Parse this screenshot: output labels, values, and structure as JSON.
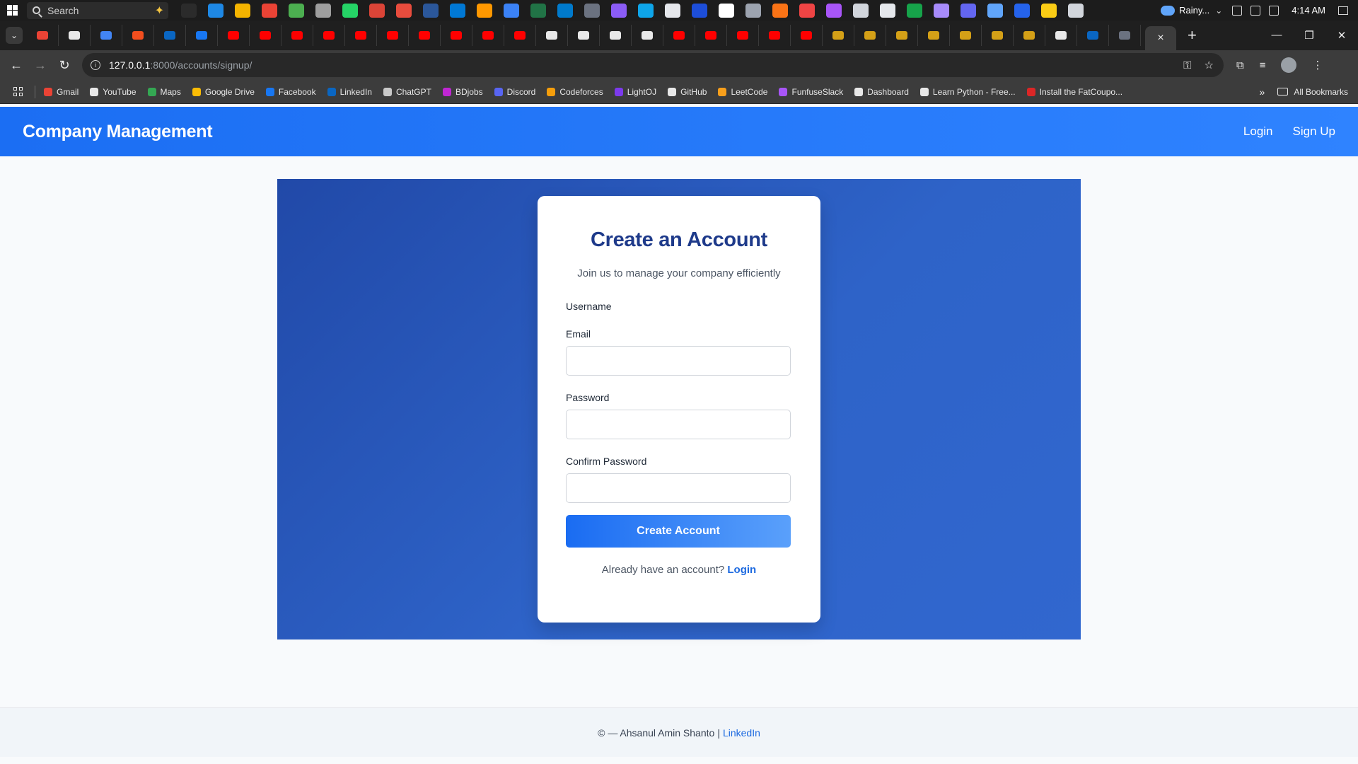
{
  "taskbar": {
    "search_placeholder": "Search",
    "weather": "Rainy...",
    "time": "4:14 AM",
    "app_colors": [
      "#2b2b2b",
      "#1e88e5",
      "#f4b400",
      "#ea4335",
      "#4caf50",
      "#9e9e9e",
      "#25d366",
      "#db4437",
      "#e84c3d",
      "#2b579a",
      "#0078d4",
      "#ff9800",
      "#3b82f6",
      "#217346",
      "#007acc",
      "#6b7280",
      "#8b5cf6",
      "#0ea5e9",
      "#e5e7eb",
      "#1d4ed8",
      "#ffffff",
      "#9ca3af",
      "#f97316",
      "#ef4444",
      "#a855f7",
      "#d1d5db",
      "#e5e7eb",
      "#16a34a",
      "#a78bfa",
      "#6366f1",
      "#60a5fa",
      "#2563eb",
      "#facc15",
      "#d1d5db"
    ]
  },
  "browser": {
    "pinned_tab_colors": [
      "#ea4335",
      "#e8e8e8",
      "#4285f4",
      "#f24e1e",
      "#0a66c2",
      "#1877f2",
      "#ff0000",
      "#ff0000",
      "#ff0000",
      "#ff0000",
      "#ff0000",
      "#ff0000",
      "#ff0000",
      "#ff0000",
      "#ff0000",
      "#ff0000",
      "#e8e8e8",
      "#e8e8e8",
      "#e8e8e8",
      "#e8e8e8",
      "#ff0000",
      "#ff0000",
      "#ff0000",
      "#ff0000",
      "#ff0000",
      "#d4a017",
      "#d4a017",
      "#d4a017",
      "#d4a017",
      "#d4a017",
      "#d4a017",
      "#d4a017",
      "#e8e8e8",
      "#0a66c2",
      "#6b7280"
    ],
    "active_tab_close": "×",
    "new_tab": "+",
    "url_host": "127.0.0.1",
    "url_path": ":8000/accounts/signup/",
    "window_minimize": "—",
    "window_restore": "❐",
    "window_close": "✕",
    "bookmarks": [
      {
        "label": "Gmail",
        "color": "#ea4335"
      },
      {
        "label": "YouTube",
        "color": "#e8e8e8"
      },
      {
        "label": "Maps",
        "color": "#34a853"
      },
      {
        "label": "Google Drive",
        "color": "#fbbc04"
      },
      {
        "label": "Facebook",
        "color": "#1877f2"
      },
      {
        "label": "LinkedIn",
        "color": "#0a66c2"
      },
      {
        "label": "ChatGPT",
        "color": "#c9c9c9"
      },
      {
        "label": "BDjobs",
        "color": "#c026d3"
      },
      {
        "label": "Discord",
        "color": "#5865f2"
      },
      {
        "label": "Codeforces",
        "color": "#f59e0b"
      },
      {
        "label": "LightOJ",
        "color": "#7c3aed"
      },
      {
        "label": "GitHub",
        "color": "#e8e8e8"
      },
      {
        "label": "LeetCode",
        "color": "#f89f1b"
      },
      {
        "label": "FunfuseSlack",
        "color": "#a855f7"
      },
      {
        "label": "Dashboard",
        "color": "#e8e8e8"
      },
      {
        "label": "Learn Python - Free...",
        "color": "#e8e8e8"
      },
      {
        "label": "Install the FatCoupo...",
        "color": "#dc2626"
      }
    ],
    "bookmarks_more": "»",
    "all_bookmarks": "All Bookmarks"
  },
  "site": {
    "brand": "Company Management",
    "nav_login": "Login",
    "nav_signup": "Sign Up",
    "colors": {
      "primary": "#1b6ef3",
      "heading": "#1e3a8a",
      "hero": "#2149a8"
    }
  },
  "form": {
    "title": "Create an Account",
    "subtitle": "Join us to manage your company efficiently",
    "username_label": "Username",
    "email_label": "Email",
    "email_value": "",
    "password_label": "Password",
    "password_value": "",
    "confirm_label": "Confirm Password",
    "confirm_value": "",
    "submit_label": "Create Account",
    "login_prompt": "Already have an account?",
    "login_link": "Login"
  },
  "footer": {
    "text": "© — Ahsanul Amin Shanto",
    "separator": "|",
    "link": "LinkedIn"
  }
}
